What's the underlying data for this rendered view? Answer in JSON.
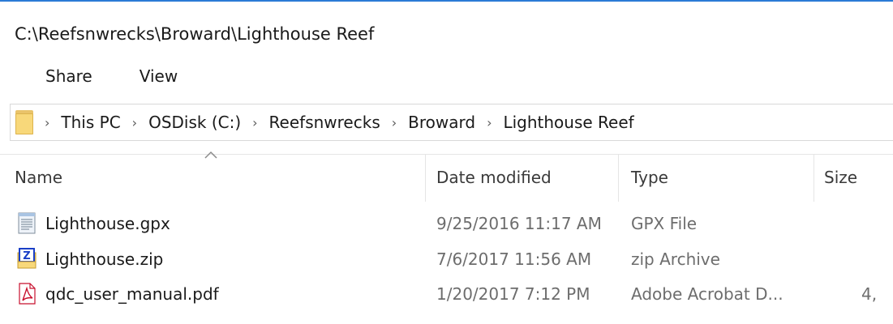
{
  "window": {
    "path_title": "C:\\Reefsnwrecks\\Broward\\Lighthouse Reef"
  },
  "ribbon": {
    "tabs": [
      {
        "label": "Share"
      },
      {
        "label": "View"
      }
    ]
  },
  "address": {
    "icon": "folder-icon",
    "crumbs": [
      {
        "label": "This PC"
      },
      {
        "label": "OSDisk (C:)"
      },
      {
        "label": "Reefsnwrecks"
      },
      {
        "label": "Broward"
      },
      {
        "label": "Lighthouse Reef"
      }
    ],
    "separator": "›"
  },
  "columns": {
    "name": "Name",
    "date": "Date modified",
    "type": "Type",
    "size": "Size",
    "sort_indicator": "ascending"
  },
  "files": [
    {
      "name": "Lighthouse.gpx",
      "icon": "text-file-icon",
      "date": "9/25/2016 11:17 AM",
      "type": "GPX File",
      "size": ""
    },
    {
      "name": "Lighthouse.zip",
      "icon": "zip-archive-icon",
      "date": "7/6/2017 11:56 AM",
      "type": "zip Archive",
      "size": ""
    },
    {
      "name": "qdc_user_manual.pdf",
      "icon": "pdf-file-icon",
      "date": "1/20/2017 7:12 PM",
      "type": "Adobe Acrobat D...",
      "size": "4,"
    }
  ],
  "colors": {
    "accent": "#2b7bd6",
    "folder": "#f8d87a",
    "pdf_red": "#c8102e",
    "zip_blue": "#1a3fc7"
  }
}
